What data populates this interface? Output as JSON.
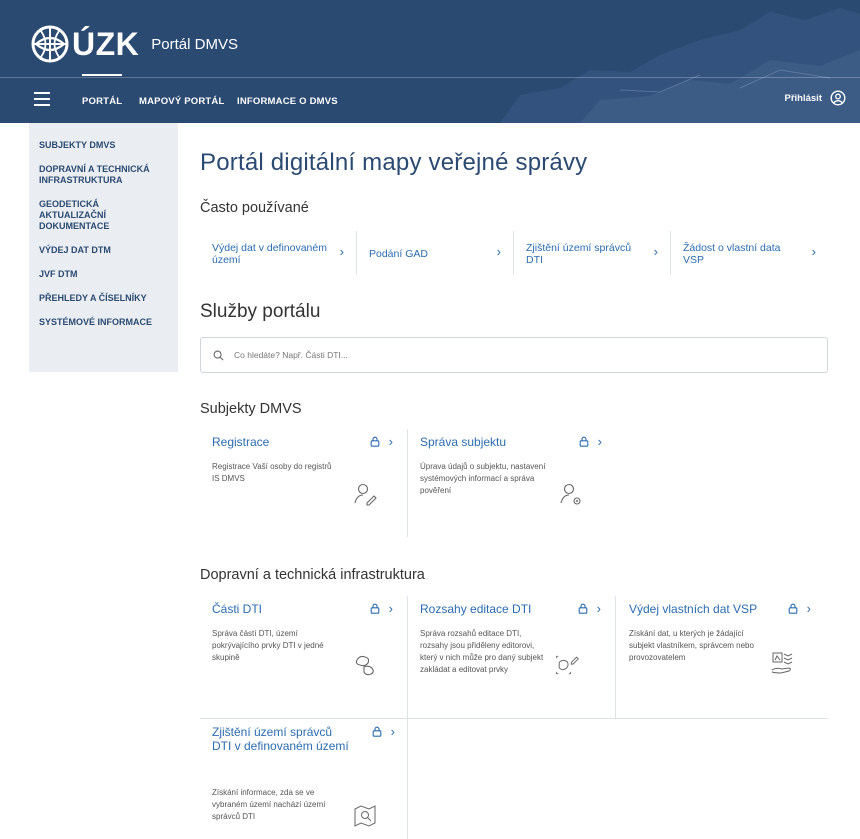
{
  "header": {
    "logo_text": "ÚZK",
    "portal_name": "Portál DMVS",
    "nav": [
      {
        "label": "PORTÁL"
      },
      {
        "label": "MAPOVÝ PORTÁL"
      },
      {
        "label": "INFORMACE O DMVS"
      }
    ],
    "login_label": "Přihlásit",
    "brand_color": "#2b4a72"
  },
  "sidebar": {
    "items": [
      {
        "label": "SUBJEKTY DMVS"
      },
      {
        "label": "DOPRAVNÍ A TECHNICKÁ INFRASTRUKTURA"
      },
      {
        "label": "GEODETICKÁ AKTUALIZAČNÍ DOKUMENTACE"
      },
      {
        "label": "VÝDEJ DAT DTM"
      },
      {
        "label": "JVF DTM"
      },
      {
        "label": "PŘEHLEDY A ČÍSELNÍKY"
      },
      {
        "label": "SYSTÉMOVÉ INFORMACE"
      }
    ]
  },
  "main": {
    "title": "Portál digitální mapy veřejné správy",
    "quick_heading": "Často používané",
    "quick_links": [
      {
        "label": "Výdej dat v definovaném území"
      },
      {
        "label": "Podání GAD"
      },
      {
        "label": "Zjištění území správců DTI"
      },
      {
        "label": "Žádost o vlastní data VSP"
      }
    ],
    "services_heading": "Služby portálu",
    "search_placeholder": "Co hledáte? Např. Části DTI...",
    "sections": [
      {
        "heading": "Subjekty DMVS",
        "cards": [
          {
            "title": "Registrace",
            "desc": "Registrace Vaší osoby do registrů IS DMVS",
            "icon": "user-edit-icon"
          },
          {
            "title": "Správa subjektu",
            "desc": "Úprava údajů o subjektu, nastavení systémových informací a správa pověření",
            "icon": "user-settings-icon"
          }
        ]
      },
      {
        "heading": "Dopravní a technická infrastruktura",
        "cards": [
          {
            "title": "Části DTI",
            "desc": "Správa částí DTI, území pokrývajícího prvky DTI v jedné skupině",
            "icon": "area-group-icon"
          },
          {
            "title": "Rozsahy editace DTI",
            "desc": "Správa rozsahů editace DTI, rozsahy jsou přiděleny editorovi, který v nich může pro daný subjekt zakládat a editovat prvky",
            "icon": "area-edit-icon"
          },
          {
            "title": "Výdej vlastních dat VSP",
            "desc": "Získání dat, u kterých je žádající subjekt vlastníkem, správcem nebo provozovatelem",
            "icon": "data-hand-icon"
          },
          {
            "title": "Zjištění území správců DTI v definovaném území",
            "desc": "Získání informace, zda se ve vybraném území nachází území správců DTI",
            "icon": "map-search-icon"
          }
        ]
      }
    ]
  }
}
